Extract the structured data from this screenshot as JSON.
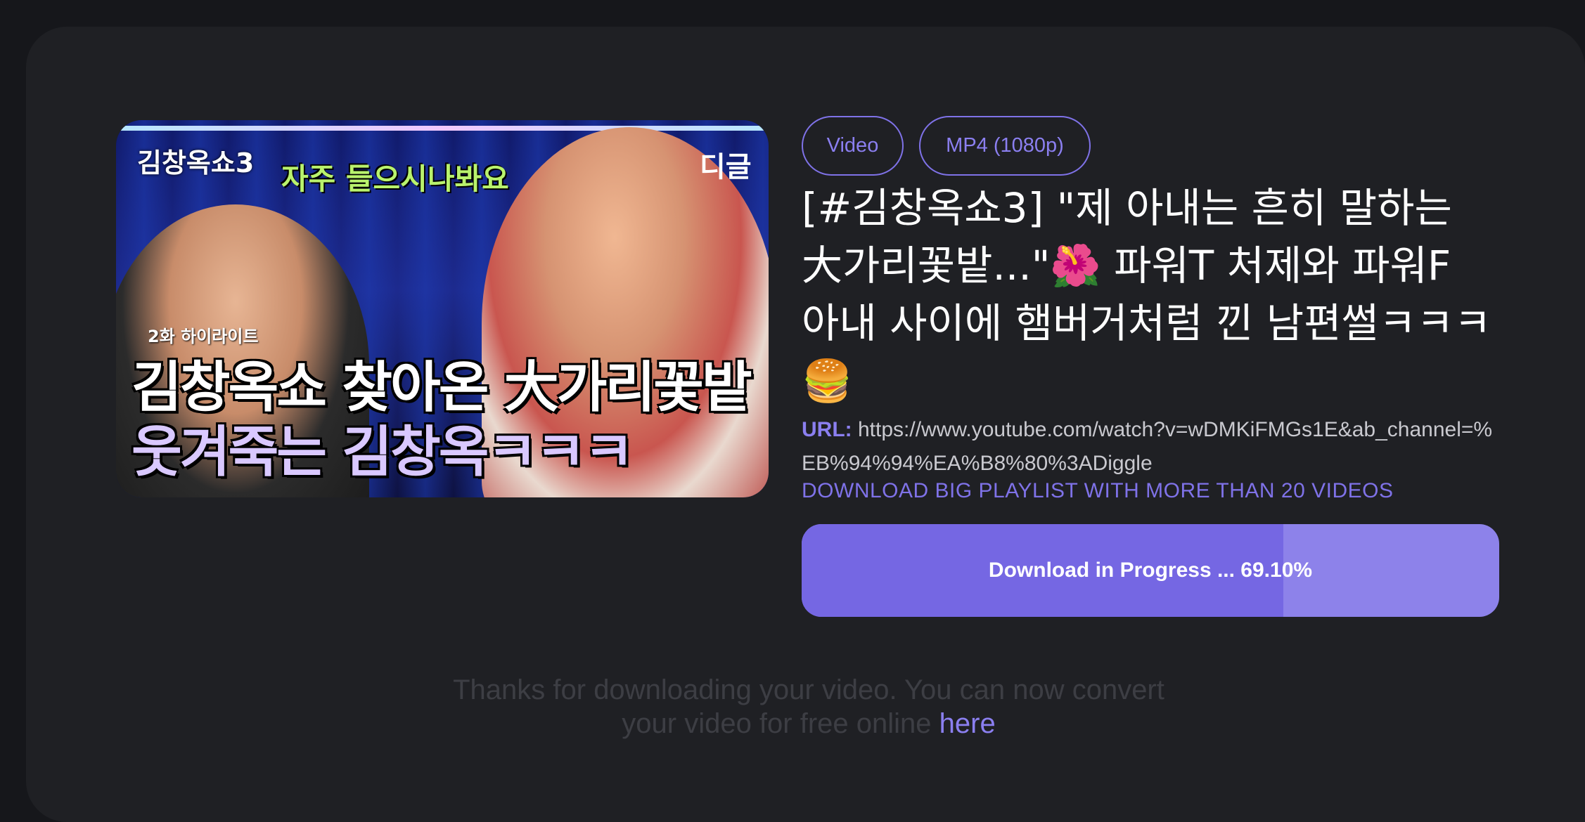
{
  "video": {
    "thumbnail": {
      "show_name": "김창옥쇼3",
      "caption": "자주 들으시나봐요",
      "channel_logo": "디글",
      "episode": "2화 하이라이트",
      "headline_line1": "김창옥쇼 찾아온 大가리꽃밭",
      "headline_line2": "웃겨죽는 김창옥ㅋㅋㅋ"
    },
    "type_tag": "Video",
    "format_tag": "MP4 (1080p)",
    "title": "[#김창옥쇼3] \"제 아내는 흔히 말하는 大가리꽃밭...\"🌺 파워T 처제와 파워F 아내 사이에 햄버거처럼 낀 남편썰ㅋㅋㅋ🍔",
    "url_label": "URL:",
    "url": "https://www.youtube.com/watch?v=wDMKiFMGs1E&ab_channel=%EB%94%94%EA%B8%80%3ADiggle",
    "playlist_link": "DOWNLOAD BIG PLAYLIST WITH MORE THAN 20 VIDEOS"
  },
  "download": {
    "progress_percent": 69.1,
    "label": "Download in Progress ... 69.10%"
  },
  "footer": {
    "thanks_text": "Thanks for downloading your video. You can now convert your video for free online",
    "here_link": "here"
  },
  "colors": {
    "accent": "#7f72e8",
    "progress_fill": "#7567e3",
    "progress_track": "#8d82ea",
    "background": "#16171b",
    "card": "#1f2024"
  }
}
